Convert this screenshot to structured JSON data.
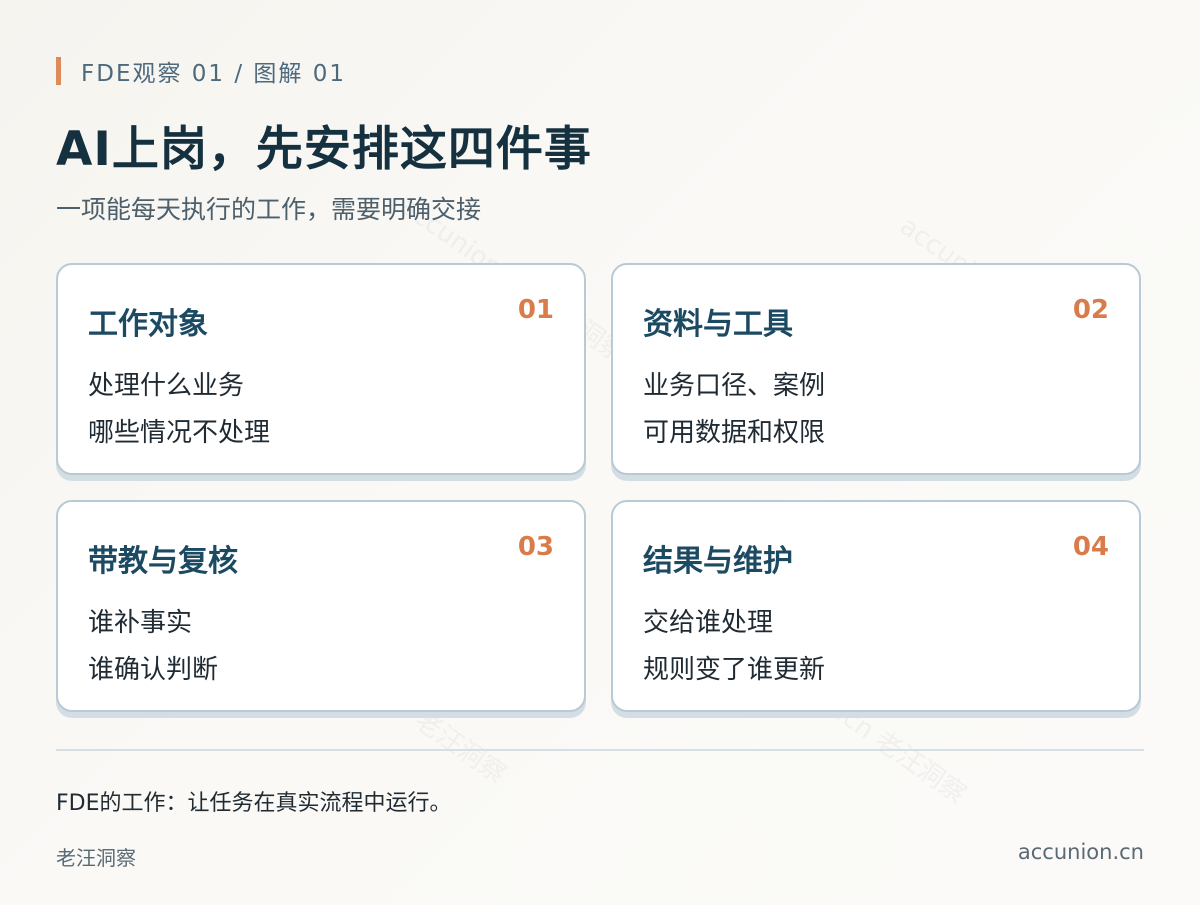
{
  "header": {
    "eyebrow": "FDE观察 01 / 图解 01",
    "title": "AI上岗，先安排这四件事",
    "subtitle": "一项能每天执行的工作，需要明确交接"
  },
  "cards": [
    {
      "title": "工作对象",
      "number": "01",
      "lines": [
        "处理什么业务",
        "哪些情况不处理"
      ]
    },
    {
      "title": "资料与工具",
      "number": "02",
      "lines": [
        "业务口径、案例",
        "可用数据和权限"
      ]
    },
    {
      "title": "带教与复核",
      "number": "03",
      "lines": [
        "谁补事实",
        "谁确认判断"
      ]
    },
    {
      "title": "结果与维护",
      "number": "04",
      "lines": [
        "交给谁处理",
        "规则变了谁更新"
      ]
    }
  ],
  "footer": {
    "note": "FDE的工作：让任务在真实流程中运行。",
    "brand": "老汪洞察",
    "site": "accunion.cn"
  },
  "watermark": {
    "text": "accunion.cn 老汪洞察"
  },
  "colors": {
    "accent": "#e08a5a",
    "number": "#d97b4a",
    "card_title": "#1c4a62",
    "title": "#15303f",
    "card_border": "#b9cad4"
  }
}
